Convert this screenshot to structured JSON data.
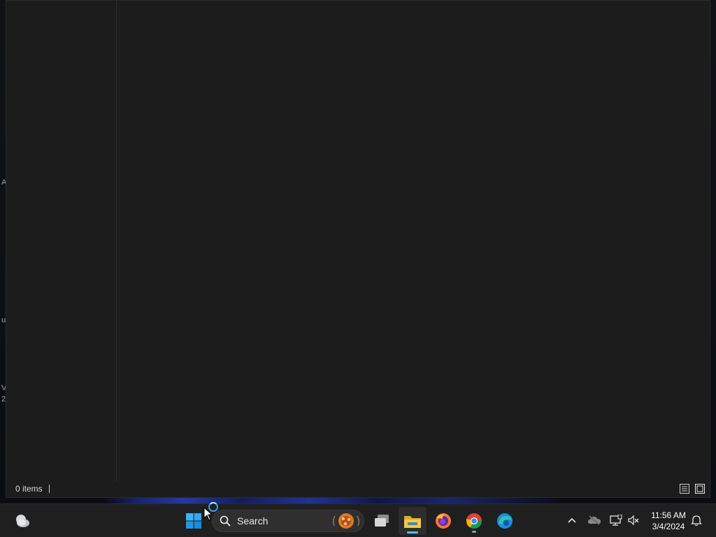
{
  "explorer": {
    "status": {
      "item_count": "0 items"
    },
    "view_buttons": [
      "details-view-icon",
      "large-icons-view-icon"
    ]
  },
  "desktop": {
    "edge_glyphs": [
      "A",
      "u",
      "V",
      "2"
    ]
  },
  "taskbar": {
    "search": {
      "label": "Search"
    },
    "apps": [
      "widgets-weather-icon",
      "start-windows-icon",
      "task-view-icon",
      "file-explorer-icon",
      "firefox-icon",
      "chrome-icon",
      "edge-icon"
    ],
    "active_app": "file-explorer-icon",
    "tray": [
      "chevron-up-icon",
      "onedrive-icon",
      "network-icon",
      "volume-muted-icon"
    ],
    "clock": {
      "time": "11:56 AM",
      "date": "3/4/2024"
    },
    "notification_icon": "bell-icon"
  },
  "colors": {
    "window_bg": "#1c1c1c",
    "taskbar_bg": "#1f1f1f",
    "accent": "#4cc2ff"
  }
}
